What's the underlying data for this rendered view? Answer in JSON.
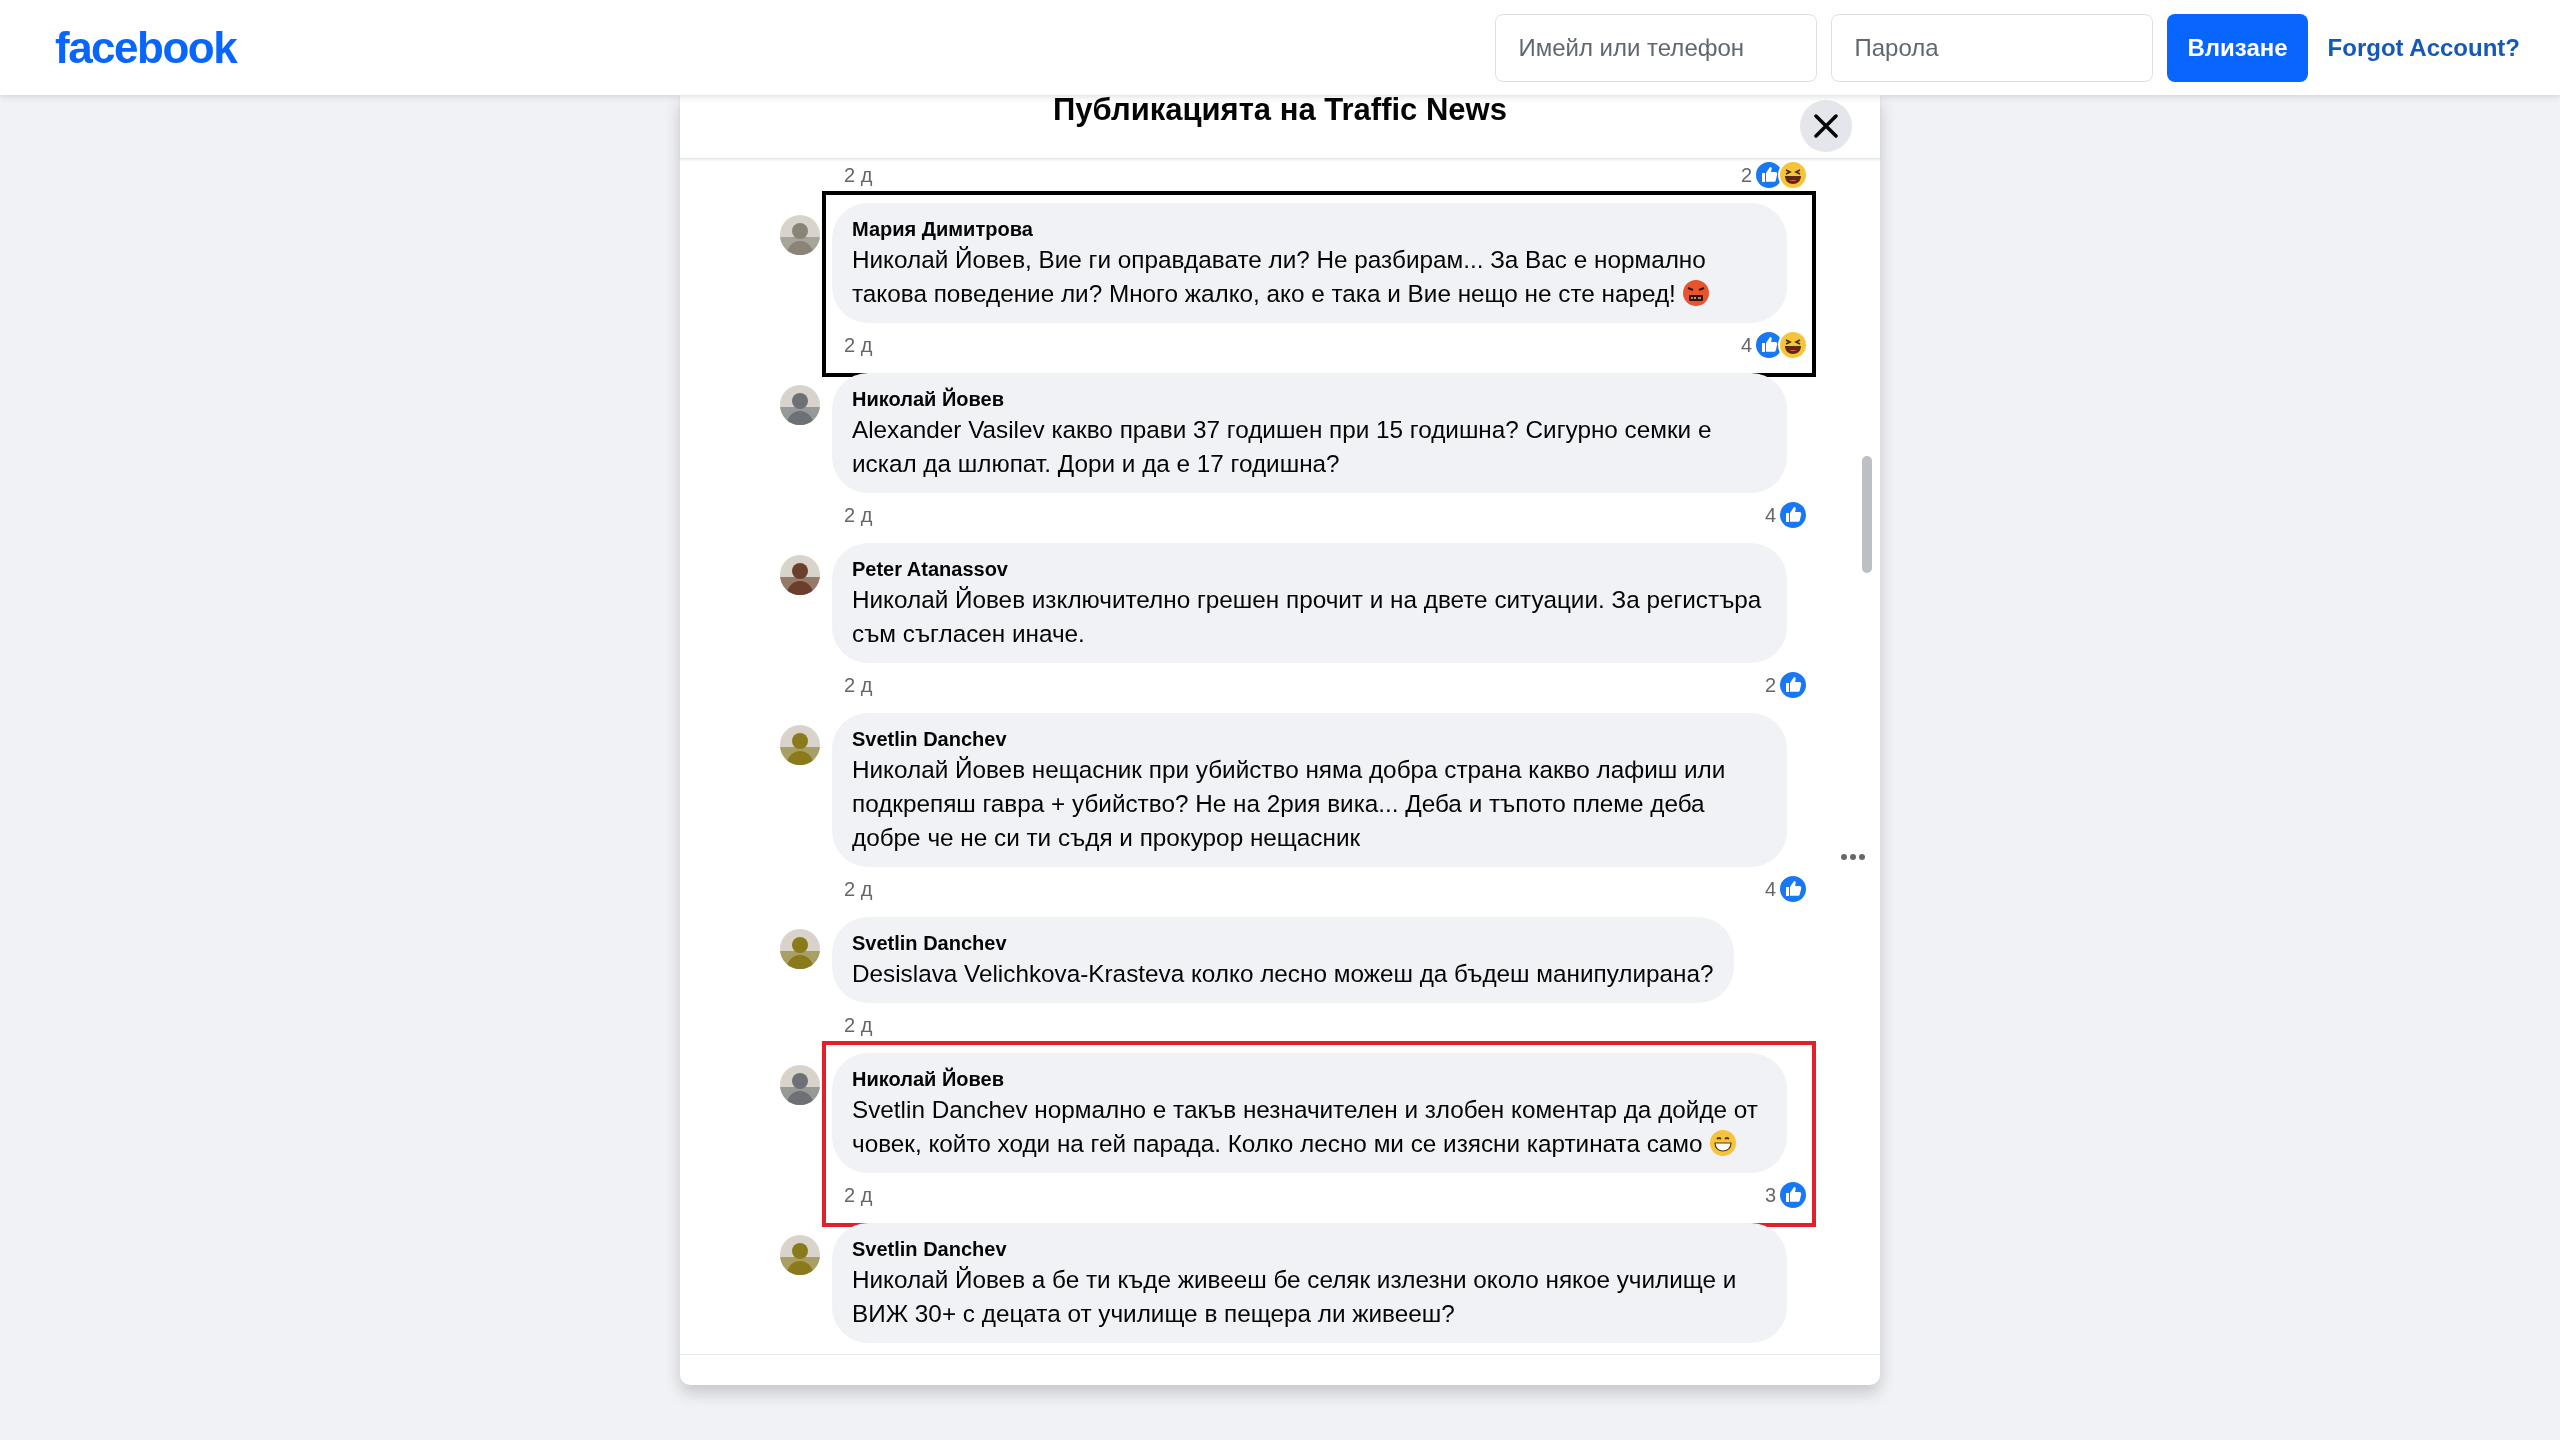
{
  "header": {
    "logo": "facebook",
    "email": {
      "placeholder": "Имейл или телефон"
    },
    "password": {
      "placeholder": "Парола"
    },
    "login_button": "Влизане",
    "forgot_link": "Forgot Account?"
  },
  "modal": {
    "title": "Публикацията на Traffic News",
    "top_meta": {
      "time": "2 д",
      "count": "2",
      "reactions": [
        {
          "kind": "like"
        },
        {
          "kind": "haha"
        }
      ]
    },
    "comments": [
      {
        "author": "Мария Димитрова",
        "text": "Николай Йовев, Вие ги оправдавате ли? Не разбирам... За Вас е нормално такова поведение ли? Много жалко, ако е така и Вие нещо не сте наред!",
        "emoji": {
          "kind": "angry"
        },
        "time": "2 д",
        "count": "4",
        "reactions": [
          {
            "kind": "like"
          },
          {
            "kind": "haha"
          }
        ],
        "highlight": {
          "color": "#000000"
        },
        "menu": false
      },
      {
        "author": "Николай Йовев",
        "text": "Alexander Vasilev какво прави 37 годишен при 15 годишна? Сигурно семки е искал да шлюпат. Дори и да е 17 годишна?",
        "time": "2 д",
        "count": "4",
        "reactions": [
          {
            "kind": "like"
          }
        ],
        "menu": false
      },
      {
        "author": "Peter Atanassov",
        "text": "Николай Йовев изключително грешен прочит и на двете ситуации. За регистъра съм съгласен иначе.",
        "time": "2 д",
        "count": "2",
        "reactions": [
          {
            "kind": "like"
          }
        ],
        "menu": false
      },
      {
        "author": "Svetlin Danchev",
        "text": "Николай Йовев нещасник при убийство няма добра страна какво лафиш или подкрепяш гавра + убийство? Не на 2рия вика... Деба и тъпото племе деба добре че не си ти съдя и прокурор нещасник",
        "time": "2 д",
        "count": "4",
        "reactions": [
          {
            "kind": "like"
          }
        ],
        "menu": true
      },
      {
        "author": "Svetlin Danchev",
        "text": "Desislava Velichkova-Krasteva колко лесно можеш да бъдеш манипулирана?",
        "time": "2 д",
        "menu": false
      },
      {
        "author": "Николай Йовев",
        "text": "Svetlin Danchev нормално е такъв незначителен и злобен коментар да дойде от човек, който ходи на гей парада. Колко лесно ми се изясни картината само",
        "emoji": {
          "kind": "grin"
        },
        "time": "2 д",
        "count": "3",
        "reactions": [
          {
            "kind": "like"
          }
        ],
        "highlight": {
          "color": "#e0202a"
        },
        "menu": false
      },
      {
        "author": "Svetlin Danchev",
        "text": "Николай Йовев а бе ти къде живееш бе селяк излезни около някое училище и ВИЖ 30+ с децата от училище в пещера ли живееш?",
        "menu": false
      }
    ]
  }
}
